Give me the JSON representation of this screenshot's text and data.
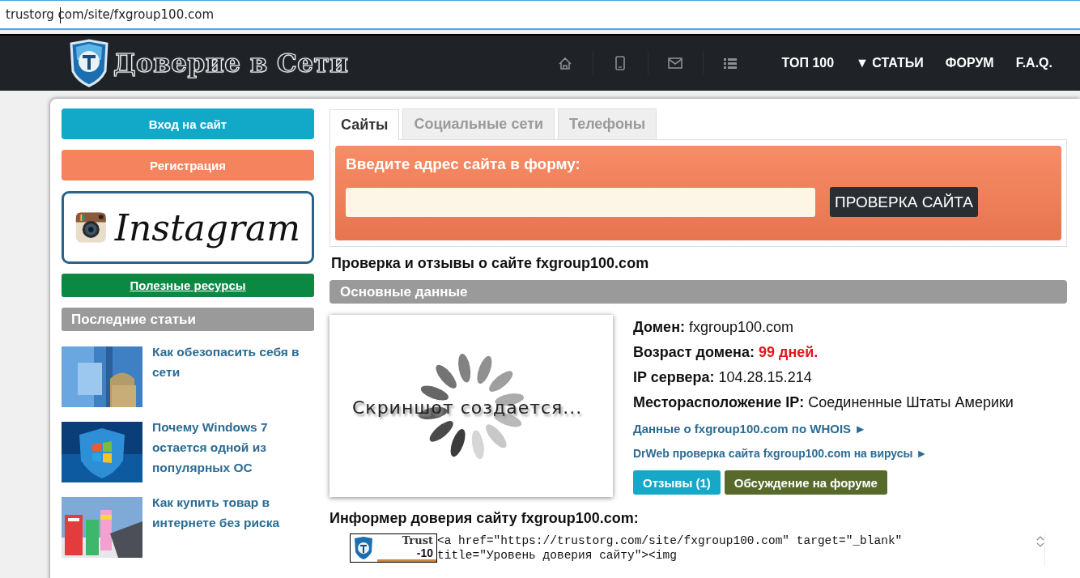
{
  "address_bar": {
    "value": "trustorg com/site/fxgroup100.com"
  },
  "header": {
    "logo_text": "Доверие в Сети",
    "icons": [
      {
        "kind": "home"
      },
      {
        "kind": "phone"
      },
      {
        "kind": "mail"
      },
      {
        "kind": "list"
      }
    ],
    "nav": [
      {
        "label": "ТОП 100"
      },
      {
        "label": "▼ СТАТЬИ"
      },
      {
        "label": "ФОРУМ"
      },
      {
        "label": "F.A.Q."
      }
    ]
  },
  "sidebar": {
    "buttons": [
      {
        "label": "Вход на сайт",
        "kind": "login"
      },
      {
        "label": "Регистрация",
        "kind": "register"
      }
    ],
    "instagram_banner": {
      "text": "Instagram"
    },
    "resources_link": "Полезные ресурсы",
    "recent_title": "Последние статьи",
    "articles": [
      {
        "title": "Как обезопасить себя в сети"
      },
      {
        "title": "Почему Windows 7 остается одной из популярных ОС"
      },
      {
        "title": "Как купить товар в интернете без риска"
      }
    ]
  },
  "main": {
    "tabs": [
      {
        "label": "Сайты",
        "selected": true
      },
      {
        "label": "Социальные сети",
        "selected": false
      },
      {
        "label": "Телефоны",
        "selected": false
      }
    ],
    "search_form": {
      "title": "Введите адрес сайта в форму:",
      "button": "ПРОВЕРКА САЙТА"
    },
    "page_title": "Проверка и отзывы о сайте fxgroup100.com",
    "section_title": "Основные данные",
    "screenshot_placeholder": {
      "text": "Скриншот создается..."
    },
    "info": [
      {
        "label": "Домен:",
        "value": "fxgroup100.com",
        "kind": "plain"
      },
      {
        "label": "Возраст домена:",
        "value": "99 дней.",
        "kind": "alert"
      },
      {
        "label": "IP сервера:",
        "value": "104.28.15.214",
        "kind": "plain"
      },
      {
        "label": "Месторасположение IP:",
        "value": "Соединенные Штаты Америки",
        "kind": "plain"
      }
    ],
    "links": [
      {
        "text": "Данные о fxgroup100.com по WHOIS ►"
      },
      {
        "text": "DrWeb проверка сайта fxgroup100.com на вирусы ►"
      }
    ],
    "actions": [
      {
        "label": "Отзывы (1)",
        "kind": "reviews"
      },
      {
        "label": "Обсуждение на форуме",
        "kind": "forum"
      }
    ],
    "informer": {
      "title": "Информер доверия сайту fxgroup100.com:",
      "badge_label": "Trust",
      "badge_value": "-10",
      "code": "<a href=\"https://trustorg.com/site/fxgroup100.com\" target=\"_blank\"\ntitle=\"Уровень доверия сайту\"><img"
    }
  }
}
